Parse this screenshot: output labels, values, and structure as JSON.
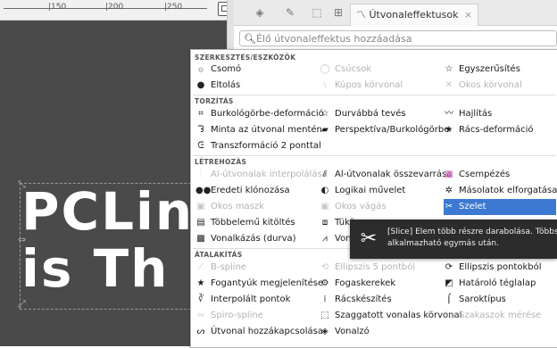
{
  "ruler": {
    "ticks": [
      "|150",
      "|200",
      "|250"
    ]
  },
  "canvas": {
    "line1": "PCLin",
    "line2": "is Th"
  },
  "tabs": {
    "active_label": "Útvonaleffektusok",
    "close": "×"
  },
  "search": {
    "placeholder": "Élő útvonaleffektus hozzáadása"
  },
  "sections": {
    "edit": "SZERKESZTÉS/ESZKÖZÖK",
    "distort": "TORZÍTÁS",
    "generate": "LÉTREHOZÁS",
    "convert": "ÁTALAKÍTÁS"
  },
  "items": {
    "edit": [
      [
        "Csomó",
        "Csúcsok",
        "Egyszerűsítés"
      ],
      [
        "Eltolás",
        "Kúpos körvonal",
        "Okos körvonal"
      ]
    ],
    "distort": [
      [
        "Burkológörbe-deformáció",
        "Durvábbá tevés",
        "Hajlítás"
      ],
      [
        "Minta az útvonal mentén",
        "Perspektíva/Burkológörbe",
        "Rács-deformáció"
      ],
      [
        "Transzformáció 2 ponttal"
      ]
    ],
    "generate": [
      [
        "Al-útvonalak interpolálása",
        "Al-útvonalak összevarrása",
        "Csempézés"
      ],
      [
        "Eredeti klónozása",
        "Logikai művelet",
        "Másolatok elforgatása"
      ],
      [
        "Okos maszk",
        "Okos vágás",
        "Szelet"
      ],
      [
        "Többelemű kitöltés",
        "Tükör",
        ""
      ],
      [
        "Vonalkázás (durva)",
        "Vonalak",
        ""
      ]
    ],
    "convert": [
      [
        "B-spline",
        "Ellipszis 5 pontból",
        "Ellipszis pontokból"
      ],
      [
        "Fogantyúk megjelenítése",
        "Fogaskerekek",
        "Határoló téglalap"
      ],
      [
        "Interpolált pontok",
        "Rácskészítés",
        "Saroktípus"
      ],
      [
        "Spiro-spline",
        "Szaggatott vonalas körvonal",
        "Szakaszok mérése"
      ],
      [
        "Útvonal hozzákapcsolása",
        "Vonalzó",
        ""
      ]
    ]
  },
  "tooltip": {
    "line1": "[Slice] Elem több részre darabolása. Többször",
    "line2": "alkalmazható egymás után."
  },
  "colors": {
    "highlight": "#3d79d2",
    "canvas": "#4a4a4a",
    "tooltip": "#2c2c2c"
  }
}
